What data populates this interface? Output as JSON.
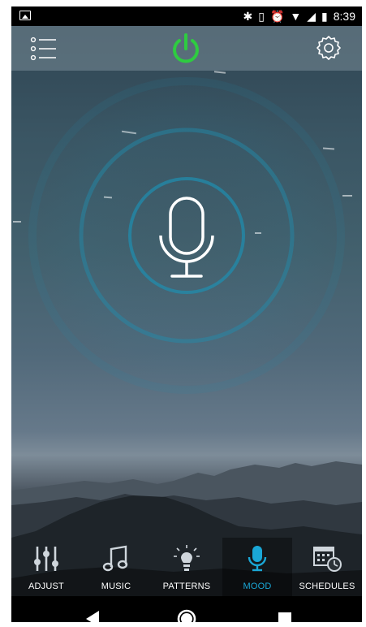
{
  "status_bar": {
    "time": "8:39",
    "icons": [
      "image-icon",
      "bluetooth-icon",
      "vibrate-icon",
      "alarm-icon",
      "wifi-icon",
      "signal-icon",
      "battery-icon"
    ]
  },
  "top_bar": {
    "power_color": "#2ecc40"
  },
  "tabs": [
    {
      "label": "ADJUST",
      "icon": "sliders-icon"
    },
    {
      "label": "MUSIC",
      "icon": "music-note-icon"
    },
    {
      "label": "PATTERNS",
      "icon": "lightbulb-icon"
    },
    {
      "label": "MOOD",
      "icon": "microphone-icon",
      "active": true
    },
    {
      "label": "SCHEDULES",
      "icon": "calendar-clock-icon"
    }
  ],
  "colors": {
    "accent": "#1aa7d6",
    "ring": "#1e8fb0"
  }
}
